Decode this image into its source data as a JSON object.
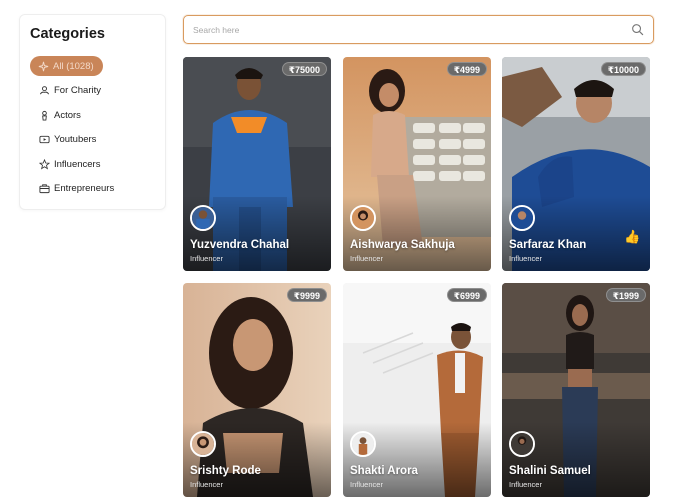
{
  "sidebar": {
    "title": "Categories",
    "items": [
      {
        "label": "All (1028)",
        "icon": "sparkle-icon",
        "active": true
      },
      {
        "label": "For Charity",
        "icon": "charity-icon"
      },
      {
        "label": "Actors",
        "icon": "actor-icon"
      },
      {
        "label": "Youtubers",
        "icon": "youtube-icon"
      },
      {
        "label": "Influencers",
        "icon": "star-icon"
      },
      {
        "label": "Entrepreneurs",
        "icon": "briefcase-icon"
      }
    ]
  },
  "search": {
    "placeholder": "Search here",
    "value": ""
  },
  "cards": [
    {
      "name": "Yuzvendra Chahal",
      "role": "Influencer",
      "price": "₹75000"
    },
    {
      "name": "Aishwarya Sakhuja",
      "role": "Influencer",
      "price": "₹4999"
    },
    {
      "name": "Sarfaraz Khan",
      "role": "Influencer",
      "price": "₹10000"
    },
    {
      "name": "Srishty Rode",
      "role": "Influencer",
      "price": "₹9999"
    },
    {
      "name": "Shakti Arora",
      "role": "Influencer",
      "price": "₹6999"
    },
    {
      "name": "Shalini Samuel",
      "role": "Influencer",
      "price": "₹1999"
    }
  ],
  "colors": {
    "accent": "#c98558",
    "search_border": "#d99b5f"
  }
}
